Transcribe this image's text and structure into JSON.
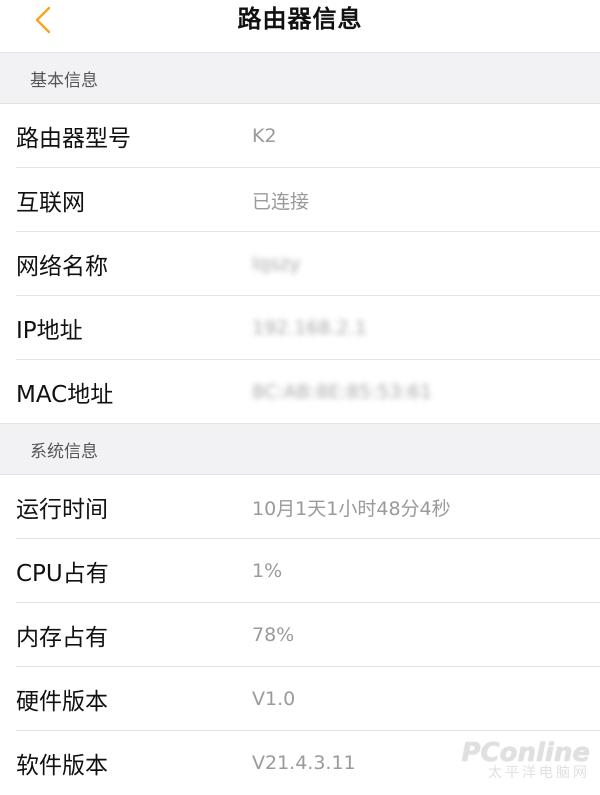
{
  "header": {
    "title": "路由器信息",
    "back_icon": "chevron-left-icon"
  },
  "colors": {
    "accent": "#f5a623",
    "section_bg": "#f2f2f4",
    "value_text": "#9a9a9a",
    "divider": "#e3e3e3"
  },
  "sections": [
    {
      "title": "基本信息",
      "rows": [
        {
          "label": "路由器型号",
          "value": "K2"
        },
        {
          "label": "互联网",
          "value": "已连接"
        },
        {
          "label": "网络名称",
          "value": "lqszy"
        },
        {
          "label": "IP地址",
          "value": "192.168.2.1"
        },
        {
          "label": "MAC地址",
          "value": "8C:AB:8E:85:53:61"
        }
      ]
    },
    {
      "title": "系统信息",
      "rows": [
        {
          "label": "运行时间",
          "value": "10月1天1小时48分4秒"
        },
        {
          "label": "CPU占有",
          "value": "1%"
        },
        {
          "label": "内存占有",
          "value": "78%"
        },
        {
          "label": "硬件版本",
          "value": "V1.0"
        },
        {
          "label": "软件版本",
          "value": "V21.4.3.11"
        }
      ]
    }
  ],
  "watermark": {
    "main": "PConline",
    "sub": "太平洋电脑网"
  }
}
